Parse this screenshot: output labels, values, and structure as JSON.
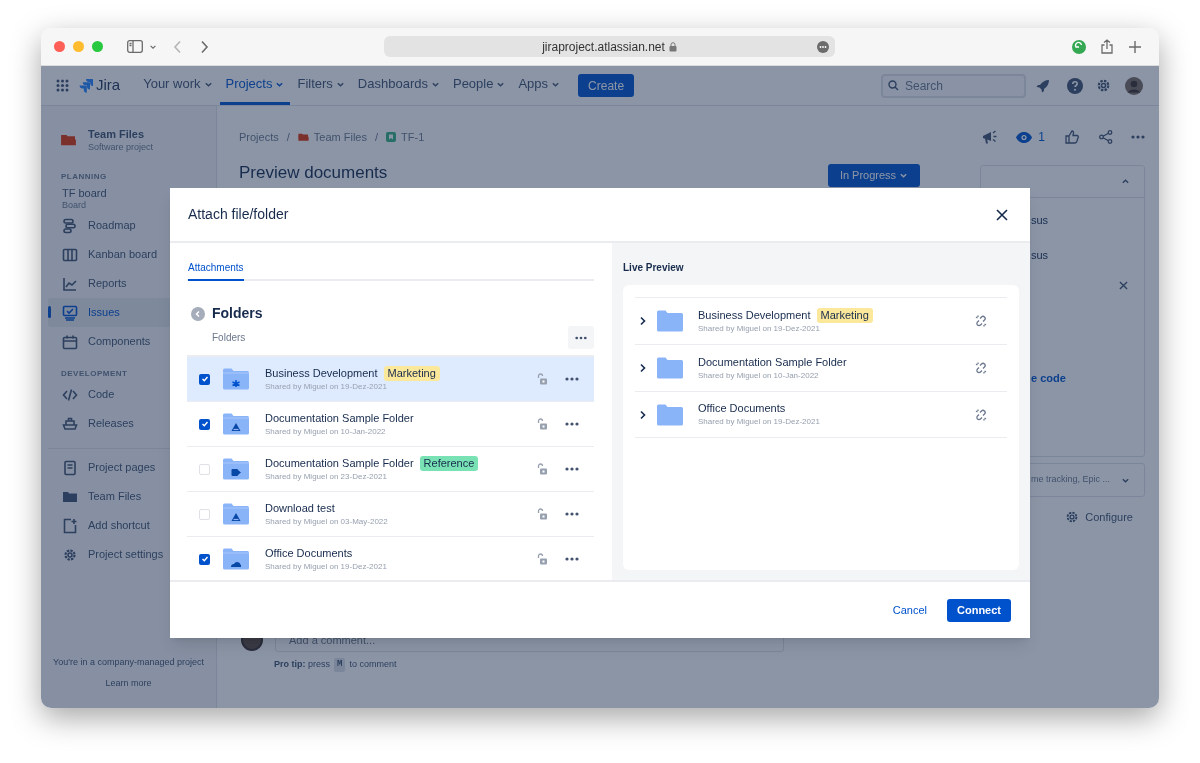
{
  "browser": {
    "url": "jiraproject.atlassian.net"
  },
  "nav": {
    "product": "Jira",
    "items": [
      {
        "label": "Your work",
        "selected": false
      },
      {
        "label": "Projects",
        "selected": true
      },
      {
        "label": "Filters",
        "selected": false
      },
      {
        "label": "Dashboards",
        "selected": false
      },
      {
        "label": "People",
        "selected": false
      },
      {
        "label": "Apps",
        "selected": false
      }
    ],
    "create": "Create",
    "search": {
      "placeholder": "Search"
    }
  },
  "sidebar": {
    "project": {
      "name": "Team Files",
      "type": "Software project"
    },
    "groups": [
      {
        "title": "PLANNING",
        "items": [
          {
            "kind": "board",
            "label": "TF board",
            "sublabel": "Board",
            "selected": false
          },
          {
            "kind": "roadmap",
            "label": "Roadmap",
            "selected": false
          },
          {
            "kind": "kanban",
            "label": "Kanban board",
            "selected": false
          },
          {
            "kind": "reports",
            "label": "Reports",
            "selected": false
          },
          {
            "kind": "issues",
            "label": "Issues",
            "selected": true
          },
          {
            "kind": "components",
            "label": "Components",
            "selected": false
          }
        ]
      },
      {
        "title": "DEVELOPMENT",
        "items": [
          {
            "kind": "code",
            "label": "Code",
            "selected": false
          },
          {
            "kind": "releases",
            "label": "Releases",
            "selected": false
          }
        ]
      },
      {
        "items": [
          {
            "kind": "pages",
            "label": "Project pages",
            "selected": false
          },
          {
            "kind": "files",
            "label": "Team Files",
            "selected": false
          },
          {
            "kind": "shortcut",
            "label": "Add shortcut",
            "selected": false
          },
          {
            "kind": "settings",
            "label": "Project settings",
            "selected": false
          }
        ]
      }
    ],
    "footer": {
      "text": "You're in a company-managed project",
      "link": "Learn more"
    }
  },
  "issue": {
    "breadcrumbs": [
      "Projects",
      "Team Files",
      "TF-1"
    ],
    "separator": "/",
    "title": "Preview documents",
    "status": "In Progress",
    "watchers": "1",
    "details": [
      "sus",
      "sus",
      "e code"
    ],
    "more_fields": "me tracking, Epic ...",
    "configure": "Configure",
    "comment": {
      "placeholder": "Add a comment..."
    },
    "pro_tip": {
      "text": "**Pro tip:** press",
      "key": "M",
      "suffix": "to comment"
    }
  },
  "modal": {
    "title": "Attach file/folder",
    "tabs": [
      {
        "label": "Attachments",
        "selected": true
      }
    ],
    "folder": {
      "title": "Folders",
      "path": "Folders"
    },
    "rows": [
      {
        "name": "Business Development",
        "tag": {
          "label": "Marketing",
          "color": "#fce89b"
        },
        "shared": "Shared by Miguel on 19-Dez-2021",
        "checked": true,
        "selected": true,
        "kind": "hub"
      },
      {
        "name": "Documentation Sample Folder",
        "shared": "Shared by Miguel on 10-Jan-2022",
        "checked": true,
        "selected": false,
        "kind": "drive"
      },
      {
        "name": "Documentation Sample Folder",
        "tag": {
          "label": "Reference",
          "color": "#79e2b5"
        },
        "shared": "Shared by Miguel on 23-Dez-2021",
        "checked": false,
        "selected": false,
        "kind": "sharepoint"
      },
      {
        "name": "Download test",
        "shared": "Shared by Miguel on 03-May-2022",
        "checked": false,
        "selected": false,
        "kind": "drive"
      },
      {
        "name": "Office Documents",
        "shared": "Shared by Miguel on 19-Dez-2021",
        "checked": true,
        "selected": false,
        "kind": "cloud"
      }
    ],
    "preview": {
      "title": "Live Preview",
      "rows": [
        {
          "name": "Business Development",
          "tag": {
            "label": "Marketing",
            "color": "#fce89b"
          },
          "shared": "Shared by Miguel on 19-Dez-2021"
        },
        {
          "name": "Documentation Sample Folder",
          "shared": "Shared by Miguel on 10-Jan-2022"
        },
        {
          "name": "Office Documents",
          "shared": "Shared by Miguel on 19-Dez-2021"
        }
      ]
    },
    "cancel": "Cancel",
    "connect": "Connect"
  }
}
